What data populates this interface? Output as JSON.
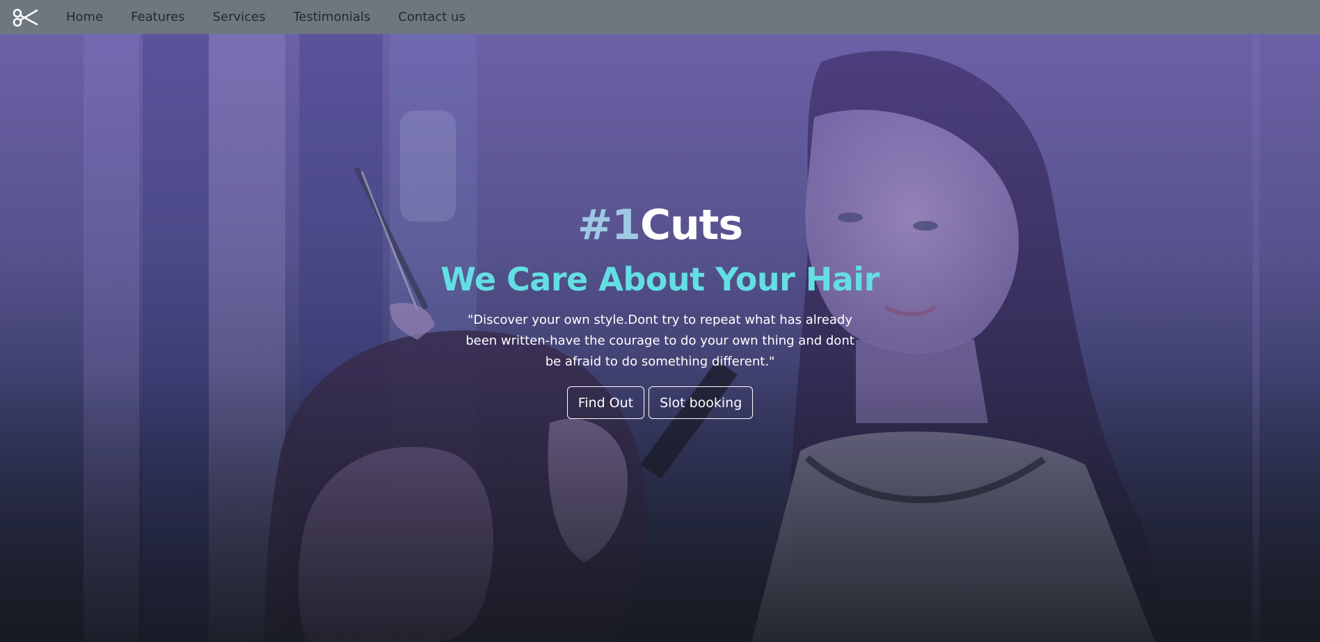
{
  "brand": {
    "icon": "scissors-icon"
  },
  "nav": {
    "items": [
      {
        "label": "Home"
      },
      {
        "label": "Features"
      },
      {
        "label": "Services"
      },
      {
        "label": "Testimonials"
      },
      {
        "label": "Contact us"
      }
    ]
  },
  "hero": {
    "title_prefix": "#1",
    "title_main": "Cuts",
    "subtitle": "We Care About Your Hair",
    "quote": "\"Discover your own style.Dont try to repeat what has already been written-have the courage to do your own thing and dont be afraid to do something different.\"",
    "buttons": {
      "find_out": "Find Out",
      "slot_booking": "Slot booking"
    }
  },
  "colors": {
    "navbar_bg": "#6d7780",
    "nav_text": "#222a31",
    "title_accent": "#9ec9e4",
    "subtitle": "#63dfe4",
    "hero_tint": "#6f63a6"
  }
}
